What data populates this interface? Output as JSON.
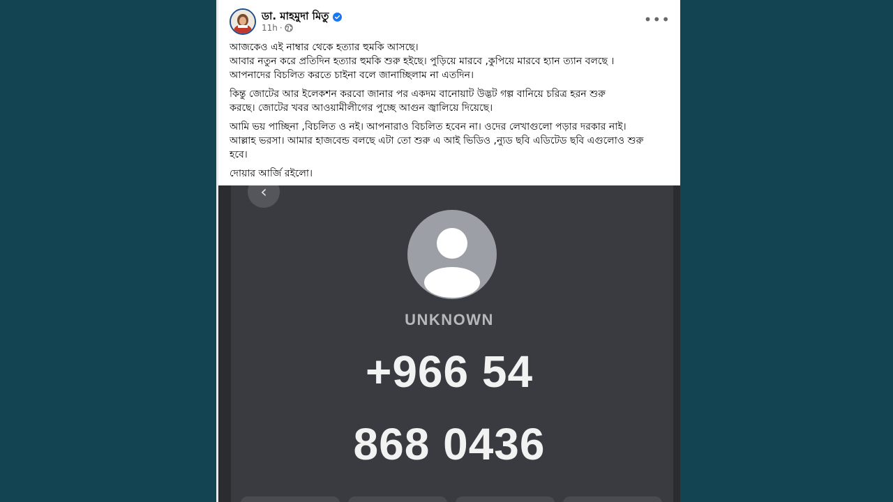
{
  "post": {
    "author": "ডা. মাহমুদা মিতু",
    "time": "11h",
    "paragraphs": [
      {
        "lines": [
          "আজকেও এই নাম্বার থেকে হত্যার হুমকি আসছে।",
          "আবার নতুন করে প্রতিদিন হত্যার হুমকি শুরু হইছে। পুড়িয়ে মারবে ,কুপিয়ে মারবে হ্যান ত্যান বলছে ।",
          "আপনাদের বিচলিত করতে চাইনা বলে জানাচ্ছিলাম না এতদিন।"
        ]
      },
      {
        "lines": [
          "কিন্তু জোটের আর ইলেকশন করবো জানার পর  একদম বানোয়াট উদ্ভট গল্প বানিয়ে চরিত্র হরন শুরু",
          "করছে। জোটের খবর আওয়ামীলীগের পুচ্ছে আগুন জ্বালিয়ে দিয়েছে।"
        ]
      },
      {
        "lines": [
          "আমি ভয় পাচ্ছিনা ,বিচলিত ও নই। আপনারাও বিচলিত হবেন না। ওদের লেখাগুলো পড়ার দরকার নাই।",
          "আল্লাহ ভরসা। আমার হাজবেন্ড বলছে এটা তো শুরু এ আই ভিডিও ,ন্যুড ছবি এডিটেড ছবি এগুলোও শুরু",
          "হবে।"
        ]
      },
      {
        "lines": [
          "দোয়ার আর্জি রইলো।"
        ]
      }
    ]
  },
  "photo": {
    "caller_label": "UNKNOWN",
    "number_line1": "+966 54",
    "number_line2": "868 0436"
  },
  "icons": {
    "more": "more-options-icon",
    "globe": "globe-icon",
    "verified": "verified-badge-icon",
    "back": "chevron-left-icon"
  },
  "colors": {
    "background": "#124452",
    "verified": "#1877f2",
    "photo_bg": "#3a3b40"
  }
}
